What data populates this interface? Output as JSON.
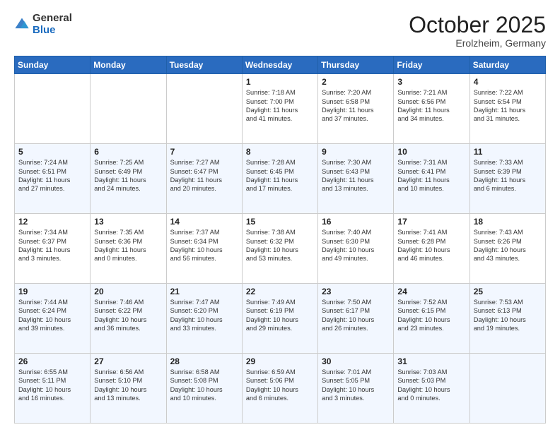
{
  "header": {
    "logo_general": "General",
    "logo_blue": "Blue",
    "month_title": "October 2025",
    "location": "Erolzheim, Germany"
  },
  "days_of_week": [
    "Sunday",
    "Monday",
    "Tuesday",
    "Wednesday",
    "Thursday",
    "Friday",
    "Saturday"
  ],
  "weeks": [
    {
      "cells": [
        {
          "day": "",
          "info": ""
        },
        {
          "day": "",
          "info": ""
        },
        {
          "day": "",
          "info": ""
        },
        {
          "day": "1",
          "info": "Sunrise: 7:18 AM\nSunset: 7:00 PM\nDaylight: 11 hours\nand 41 minutes."
        },
        {
          "day": "2",
          "info": "Sunrise: 7:20 AM\nSunset: 6:58 PM\nDaylight: 11 hours\nand 37 minutes."
        },
        {
          "day": "3",
          "info": "Sunrise: 7:21 AM\nSunset: 6:56 PM\nDaylight: 11 hours\nand 34 minutes."
        },
        {
          "day": "4",
          "info": "Sunrise: 7:22 AM\nSunset: 6:54 PM\nDaylight: 11 hours\nand 31 minutes."
        }
      ]
    },
    {
      "cells": [
        {
          "day": "5",
          "info": "Sunrise: 7:24 AM\nSunset: 6:51 PM\nDaylight: 11 hours\nand 27 minutes."
        },
        {
          "day": "6",
          "info": "Sunrise: 7:25 AM\nSunset: 6:49 PM\nDaylight: 11 hours\nand 24 minutes."
        },
        {
          "day": "7",
          "info": "Sunrise: 7:27 AM\nSunset: 6:47 PM\nDaylight: 11 hours\nand 20 minutes."
        },
        {
          "day": "8",
          "info": "Sunrise: 7:28 AM\nSunset: 6:45 PM\nDaylight: 11 hours\nand 17 minutes."
        },
        {
          "day": "9",
          "info": "Sunrise: 7:30 AM\nSunset: 6:43 PM\nDaylight: 11 hours\nand 13 minutes."
        },
        {
          "day": "10",
          "info": "Sunrise: 7:31 AM\nSunset: 6:41 PM\nDaylight: 11 hours\nand 10 minutes."
        },
        {
          "day": "11",
          "info": "Sunrise: 7:33 AM\nSunset: 6:39 PM\nDaylight: 11 hours\nand 6 minutes."
        }
      ]
    },
    {
      "cells": [
        {
          "day": "12",
          "info": "Sunrise: 7:34 AM\nSunset: 6:37 PM\nDaylight: 11 hours\nand 3 minutes."
        },
        {
          "day": "13",
          "info": "Sunrise: 7:35 AM\nSunset: 6:36 PM\nDaylight: 11 hours\nand 0 minutes."
        },
        {
          "day": "14",
          "info": "Sunrise: 7:37 AM\nSunset: 6:34 PM\nDaylight: 10 hours\nand 56 minutes."
        },
        {
          "day": "15",
          "info": "Sunrise: 7:38 AM\nSunset: 6:32 PM\nDaylight: 10 hours\nand 53 minutes."
        },
        {
          "day": "16",
          "info": "Sunrise: 7:40 AM\nSunset: 6:30 PM\nDaylight: 10 hours\nand 49 minutes."
        },
        {
          "day": "17",
          "info": "Sunrise: 7:41 AM\nSunset: 6:28 PM\nDaylight: 10 hours\nand 46 minutes."
        },
        {
          "day": "18",
          "info": "Sunrise: 7:43 AM\nSunset: 6:26 PM\nDaylight: 10 hours\nand 43 minutes."
        }
      ]
    },
    {
      "cells": [
        {
          "day": "19",
          "info": "Sunrise: 7:44 AM\nSunset: 6:24 PM\nDaylight: 10 hours\nand 39 minutes."
        },
        {
          "day": "20",
          "info": "Sunrise: 7:46 AM\nSunset: 6:22 PM\nDaylight: 10 hours\nand 36 minutes."
        },
        {
          "day": "21",
          "info": "Sunrise: 7:47 AM\nSunset: 6:20 PM\nDaylight: 10 hours\nand 33 minutes."
        },
        {
          "day": "22",
          "info": "Sunrise: 7:49 AM\nSunset: 6:19 PM\nDaylight: 10 hours\nand 29 minutes."
        },
        {
          "day": "23",
          "info": "Sunrise: 7:50 AM\nSunset: 6:17 PM\nDaylight: 10 hours\nand 26 minutes."
        },
        {
          "day": "24",
          "info": "Sunrise: 7:52 AM\nSunset: 6:15 PM\nDaylight: 10 hours\nand 23 minutes."
        },
        {
          "day": "25",
          "info": "Sunrise: 7:53 AM\nSunset: 6:13 PM\nDaylight: 10 hours\nand 19 minutes."
        }
      ]
    },
    {
      "cells": [
        {
          "day": "26",
          "info": "Sunrise: 6:55 AM\nSunset: 5:11 PM\nDaylight: 10 hours\nand 16 minutes."
        },
        {
          "day": "27",
          "info": "Sunrise: 6:56 AM\nSunset: 5:10 PM\nDaylight: 10 hours\nand 13 minutes."
        },
        {
          "day": "28",
          "info": "Sunrise: 6:58 AM\nSunset: 5:08 PM\nDaylight: 10 hours\nand 10 minutes."
        },
        {
          "day": "29",
          "info": "Sunrise: 6:59 AM\nSunset: 5:06 PM\nDaylight: 10 hours\nand 6 minutes."
        },
        {
          "day": "30",
          "info": "Sunrise: 7:01 AM\nSunset: 5:05 PM\nDaylight: 10 hours\nand 3 minutes."
        },
        {
          "day": "31",
          "info": "Sunrise: 7:03 AM\nSunset: 5:03 PM\nDaylight: 10 hours\nand 0 minutes."
        },
        {
          "day": "",
          "info": ""
        }
      ]
    }
  ]
}
